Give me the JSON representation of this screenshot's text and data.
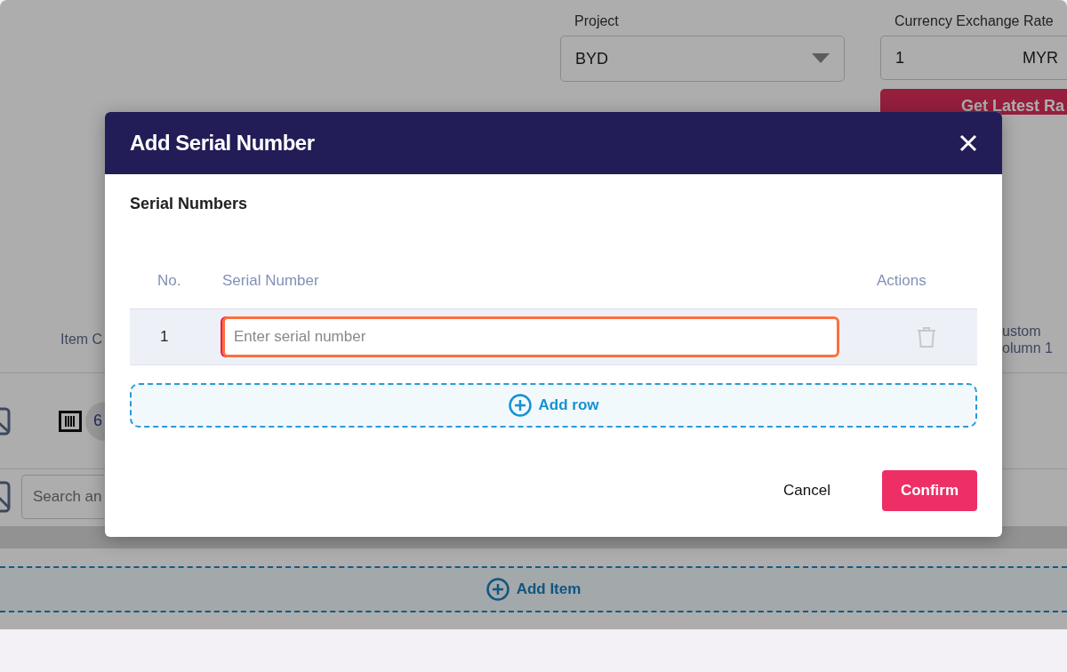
{
  "page": {
    "project": {
      "label": "Project",
      "value": "BYD"
    },
    "exchange_rate": {
      "label": "Currency Exchange Rate",
      "value": "1",
      "currency": "MYR",
      "button": "Get Latest Ra"
    },
    "items_table": {
      "column_1": "Item C",
      "column_2": [
        "ustom",
        "olumn 1"
      ]
    },
    "item_row": {
      "count": "6"
    },
    "search": {
      "placeholder": "Search an"
    },
    "add_item": "Add Item"
  },
  "dialog": {
    "title": "Add Serial Number",
    "section": "Serial Numbers",
    "columns": [
      "No.",
      "Serial Number",
      "Actions"
    ],
    "rows": [
      {
        "no": "1",
        "placeholder": "Enter serial number",
        "focused": true
      }
    ],
    "add_row": "Add row",
    "buttons": {
      "cancel": "Cancel",
      "confirm": "Confirm"
    }
  }
}
